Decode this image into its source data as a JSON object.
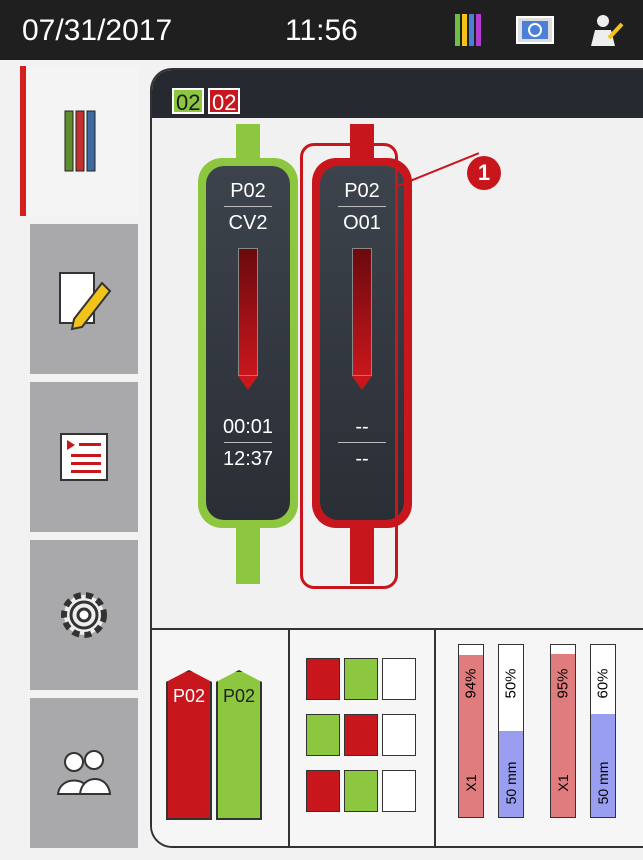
{
  "status_bar": {
    "date": "07/31/2017",
    "time": "11:56",
    "icons": [
      "reagent-tubes-icon",
      "display-icon",
      "user-icon"
    ]
  },
  "sidebar": {
    "tabs": [
      {
        "icon": "slide-carriers-icon",
        "active": true
      },
      {
        "icon": "edit-note-icon",
        "active": false
      },
      {
        "icon": "program-list-icon",
        "active": false
      },
      {
        "icon": "settings-gear-icon",
        "active": false
      },
      {
        "icon": "users-icon",
        "active": false
      }
    ]
  },
  "main": {
    "badges": [
      "02",
      "02"
    ],
    "carriers": [
      {
        "program": "P02",
        "step": "CV2",
        "time_remaining": "00:01",
        "end_time": "12:37",
        "color": "#8dc63f"
      },
      {
        "program": "P02",
        "step": "O01",
        "time_remaining": "--",
        "end_time": "--",
        "color": "#c8161d"
      }
    ],
    "callout": "1",
    "lower": {
      "racks": [
        {
          "label": "P02",
          "color": "#c8161d"
        },
        {
          "label": "P02",
          "color": "#8dc63f"
        }
      ],
      "bars": [
        {
          "pct": "94%",
          "sub": "X1",
          "fill": 0.94,
          "color": "#e07c7e"
        },
        {
          "pct": "50%",
          "sub": "50 mm",
          "fill": 0.5,
          "color": "#9a9ef0"
        },
        {
          "pct": "95%",
          "sub": "X1",
          "fill": 0.95,
          "color": "#e07c7e"
        },
        {
          "pct": "60%",
          "sub": "50 mm",
          "fill": 0.6,
          "color": "#9a9ef0"
        }
      ]
    }
  }
}
